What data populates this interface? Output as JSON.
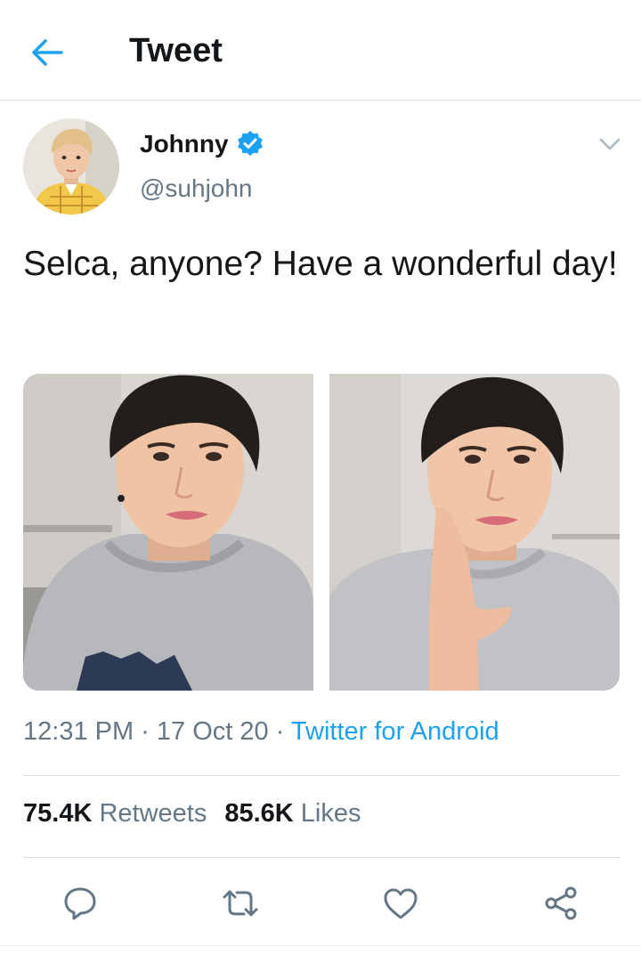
{
  "header": {
    "title": "Tweet",
    "back_icon": "arrow-left-icon"
  },
  "author": {
    "name": "Johnny",
    "handle": "@suhjohn",
    "verified": true
  },
  "tweet": {
    "text": "Selca, anyone? Have a wonderful day!",
    "time": "12:31 PM",
    "date": "17 Oct 20",
    "source": "Twitter for Android",
    "separator": " · "
  },
  "stats": {
    "retweets_count": "75.4K",
    "retweets_label": "Retweets",
    "likes_count": "85.6K",
    "likes_label": "Likes"
  },
  "actions": [
    "reply-icon",
    "retweet-icon",
    "like-icon",
    "share-icon"
  ],
  "colors": {
    "accent": "#1da1f2",
    "text": "#14171a",
    "secondary": "#657786",
    "divider": "#d8dde1"
  }
}
